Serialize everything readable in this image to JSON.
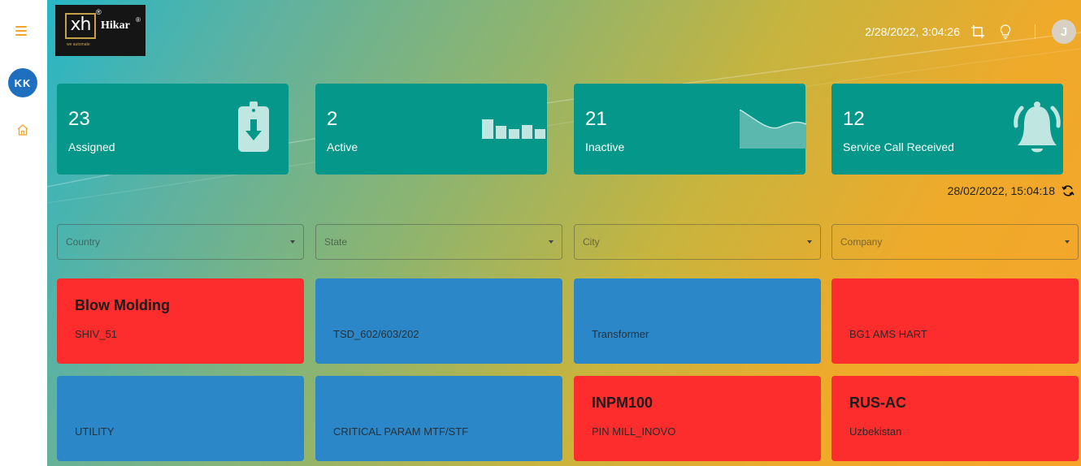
{
  "sidebar": {
    "menu_icon": "hamburger-icon",
    "user_initials": "KK",
    "home_icon": "home-icon"
  },
  "logo": {
    "monogram": "xh",
    "name": "Hikar",
    "tagline": "we automate"
  },
  "header": {
    "datetime": "2/28/2022, 3:04:26",
    "icons": [
      "crop-icon",
      "lightbulb-icon"
    ],
    "avatar_initial": "J"
  },
  "stats": [
    {
      "value": "23",
      "label": "Assigned",
      "icon": "clipboard-download-icon"
    },
    {
      "value": "2",
      "label": "Active",
      "icon": "bar-chart-icon"
    },
    {
      "value": "21",
      "label": "Inactive",
      "icon": "area-chart-icon"
    },
    {
      "value": "12",
      "label": "Service Call Received",
      "icon": "bell-icon"
    }
  ],
  "last_refreshed": "28/02/2022, 15:04:18",
  "filters": [
    {
      "placeholder": "Country"
    },
    {
      "placeholder": "State"
    },
    {
      "placeholder": "City"
    },
    {
      "placeholder": "Company"
    }
  ],
  "machines": [
    {
      "title": "Blow Molding",
      "subtitle": "SHIV_51",
      "status": "inactive"
    },
    {
      "title": "",
      "subtitle": "TSD_602/603/202",
      "status": "active"
    },
    {
      "title": "",
      "subtitle": "Transformer",
      "status": "active"
    },
    {
      "title": "",
      "subtitle": "BG1 AMS HART",
      "status": "inactive"
    },
    {
      "title": "",
      "subtitle": "UTILITY",
      "status": "active"
    },
    {
      "title": "",
      "subtitle": "CRITICAL PARAM MTF/STF",
      "status": "active"
    },
    {
      "title": "INPM100",
      "subtitle": "PIN MILL_INOVO",
      "status": "inactive"
    },
    {
      "title": "RUS-AC",
      "subtitle": "Uzbekistan",
      "status": "inactive"
    }
  ],
  "colors": {
    "stat_card": "#05978a",
    "machine_active": "#2c87c8",
    "machine_inactive": "#fc2d2c",
    "accent": "#f2a531"
  }
}
